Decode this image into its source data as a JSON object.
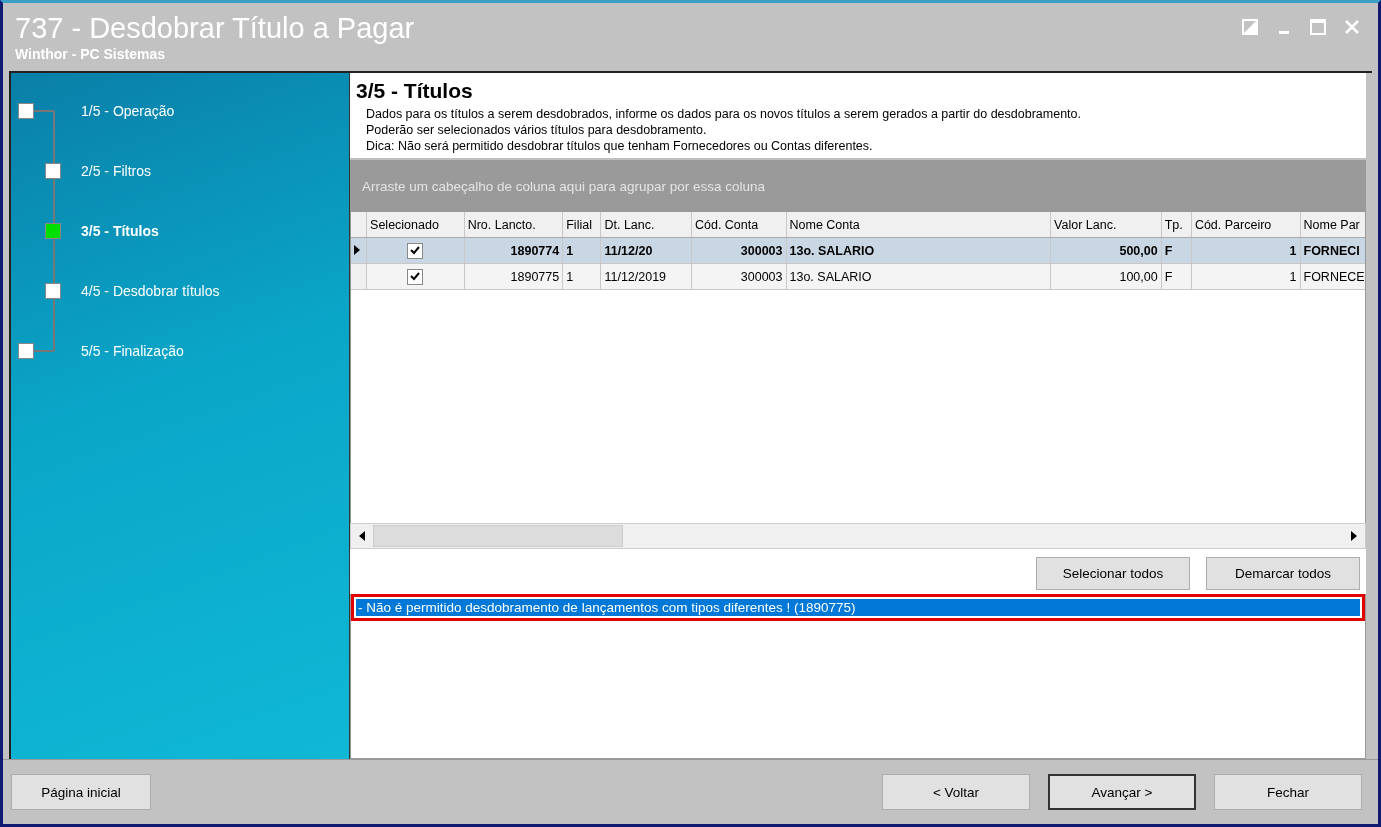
{
  "window": {
    "title": "737 - Desdobrar Título a Pagar",
    "subtitle": "Winthor - PC Sistemas"
  },
  "steps": [
    {
      "label": "1/5 - Operação",
      "selected": false,
      "kind": "outer"
    },
    {
      "label": "2/5 - Filtros",
      "selected": false,
      "kind": "inner"
    },
    {
      "label": "3/5 - Títulos",
      "selected": true,
      "kind": "inner"
    },
    {
      "label": "4/5 - Desdobrar títulos",
      "selected": false,
      "kind": "inner"
    },
    {
      "label": "5/5 - Finalização",
      "selected": false,
      "kind": "outer"
    }
  ],
  "page": {
    "heading": "3/5 - Títulos",
    "description": [
      "Dados para os títulos a serem desdobrados, informe os dados para os novos títulos a serem gerados a partir do desdobramento.",
      "Poderão ser selecionados vários títulos para desdobramento.",
      "Dica: Não será permitido desdobrar títulos que tenham Fornecedores ou Contas diferentes."
    ]
  },
  "group_panel": {
    "placeholder": "Arraste um cabeçalho de coluna aqui para agrupar por essa coluna"
  },
  "table": {
    "columns": [
      "Selecionado",
      "Nro. Lancto.",
      "Filial",
      "Dt. Lanc.",
      "Cód. Conta",
      "Nome Conta",
      "Valor Lanc.",
      "Tp.",
      "Cód. Parceiro",
      "Nome Par"
    ],
    "rows": [
      {
        "selected": true,
        "checked": true,
        "cells": [
          "",
          "1890774",
          "1",
          "11/12/20",
          "300003",
          "13o. SALARIO",
          "500,00",
          "F",
          "1",
          "FORNECI"
        ]
      },
      {
        "selected": false,
        "checked": true,
        "cells": [
          "",
          "1890775",
          "1",
          "11/12/2019",
          "300003",
          "13o. SALARIO",
          "100,00",
          "F",
          "1",
          "FORNECE"
        ]
      }
    ]
  },
  "actions": [
    "Selecionar todos",
    "Demarcar todos"
  ],
  "messages": [
    {
      "text": "- Não é permitido desdobramento de lançamentos com tipos diferentes ! (1890775)",
      "selected": true,
      "highlighted": true
    }
  ],
  "footer": {
    "left": "Página inicial",
    "buttons": [
      "< Voltar",
      "Avançar >",
      "Fechar"
    ]
  }
}
